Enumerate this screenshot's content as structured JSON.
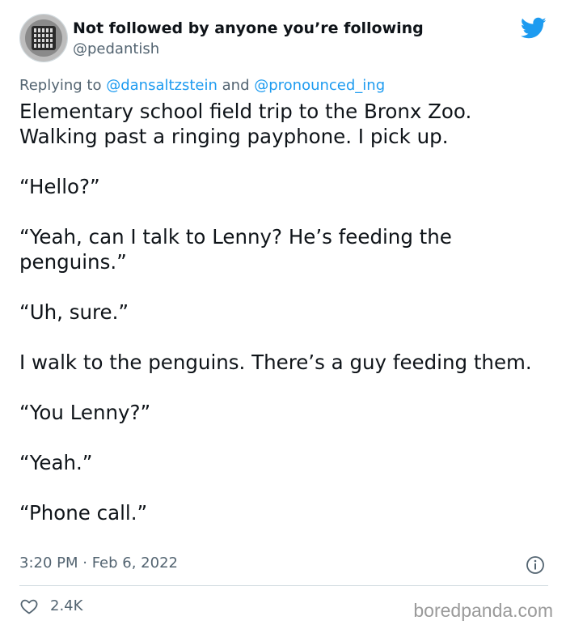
{
  "tweet": {
    "display_name": "Not followed by anyone you’re following",
    "handle": "@pedantish",
    "replying_prefix": "Replying to ",
    "replying_mention_1": "@dansaltzstein",
    "replying_and": " and ",
    "replying_mention_2": "@pronounced_ing",
    "paragraphs": [
      "Elementary school field trip to the Bronx Zoo. Walking past a ringing payphone. I pick up.",
      "“Hello?”",
      "“Yeah, can I talk to Lenny? He’s feeding the penguins.”",
      "“Uh, sure.”",
      "I walk to the penguins. There’s a guy feeding them.",
      "“You Lenny?”",
      "“Yeah.”",
      "“Phone call.”"
    ],
    "timestamp": "3:20 PM · Feb 6, 2022",
    "like_count": "2.4K"
  },
  "icons": {
    "avatar": "drain-grate-avatar",
    "brand": "twitter-bird-icon",
    "info": "info-icon",
    "like": "heart-icon"
  },
  "colors": {
    "accent": "#1d9bf0",
    "text": "#0f1419",
    "secondary": "#536471",
    "divider": "#cfd9de"
  },
  "watermark": "boredpanda.com"
}
